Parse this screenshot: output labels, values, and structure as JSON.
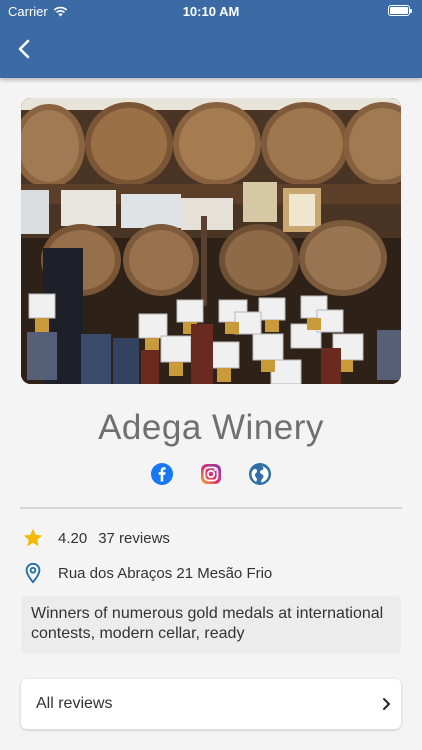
{
  "status_bar": {
    "carrier": "Carrier",
    "time": "10:10 AM"
  },
  "app_bar": {
    "back_icon": "chevron-left-icon",
    "color": "#3b6aa5"
  },
  "winery": {
    "name": "Adega Winery",
    "rating": "4.20",
    "reviews": "37 reviews",
    "address": "Rua dos Abraços 21 Mesão Frio",
    "description": "Winners of numerous gold medals at international contests, modern cellar, ready"
  },
  "socials": [
    {
      "name": "facebook-icon",
      "color": "#1877f2"
    },
    {
      "name": "instagram-icon",
      "color": "#d6297a"
    },
    {
      "name": "globe-icon",
      "color": "#2f6fa6"
    }
  ],
  "reviews_card": {
    "label": "All reviews",
    "icon": "chevron-right-icon"
  },
  "colors": {
    "star": "#f5b800",
    "pin": "#1f6fa4"
  }
}
